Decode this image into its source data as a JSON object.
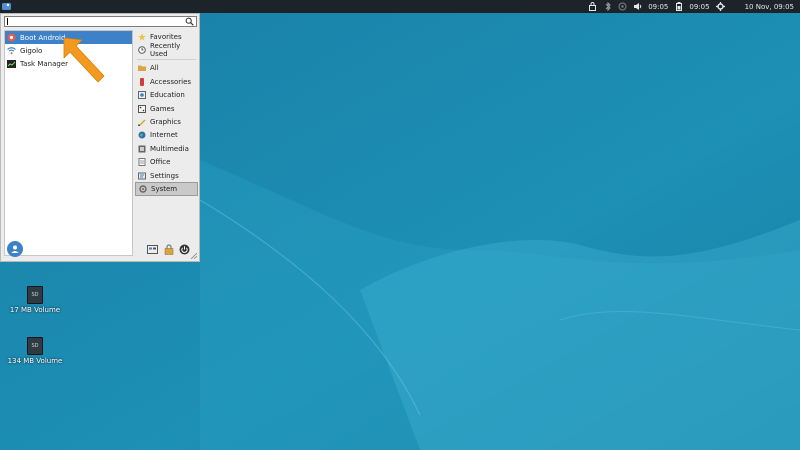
{
  "colors": {
    "panel": "#1c2329",
    "accent": "#3d82c9",
    "arrow": "#f29a1f",
    "desktop": "#1f8db0"
  },
  "panel": {
    "time": "09:05",
    "time2": "09:05",
    "date": "10 Nov, 09:05",
    "icons": [
      "xfce-menu-icon",
      "lock-icon",
      "bluetooth-icon",
      "network-icon",
      "volume-icon",
      "battery-icon",
      "gear-icon"
    ]
  },
  "desktop_icons": [
    {
      "label": "17 MB Volume",
      "badge": "SD"
    },
    {
      "label": "134 MB Volume",
      "badge": "SD"
    }
  ],
  "menu": {
    "search": {
      "value": "",
      "placeholder": ""
    },
    "apps": [
      {
        "label": "Boot Android",
        "icon": "android-boot-icon",
        "selected": true
      },
      {
        "label": "Gigolo",
        "icon": "wifi-icon",
        "selected": false
      },
      {
        "label": "Task Manager",
        "icon": "task-manager-icon",
        "selected": false
      }
    ],
    "categories_top": [
      {
        "label": "Favorites",
        "icon": "star-icon"
      },
      {
        "label": "Recently Used",
        "icon": "clock-icon"
      }
    ],
    "categories": [
      {
        "label": "All",
        "icon": "folder-icon"
      },
      {
        "label": "Accessories",
        "icon": "accessories-icon"
      },
      {
        "label": "Education",
        "icon": "education-icon"
      },
      {
        "label": "Games",
        "icon": "games-icon"
      },
      {
        "label": "Graphics",
        "icon": "graphics-icon"
      },
      {
        "label": "Internet",
        "icon": "globe-icon"
      },
      {
        "label": "Multimedia",
        "icon": "multimedia-icon"
      },
      {
        "label": "Office",
        "icon": "office-icon"
      },
      {
        "label": "Settings",
        "icon": "settings-icon"
      },
      {
        "label": "System",
        "icon": "system-icon",
        "selected": true
      }
    ]
  }
}
